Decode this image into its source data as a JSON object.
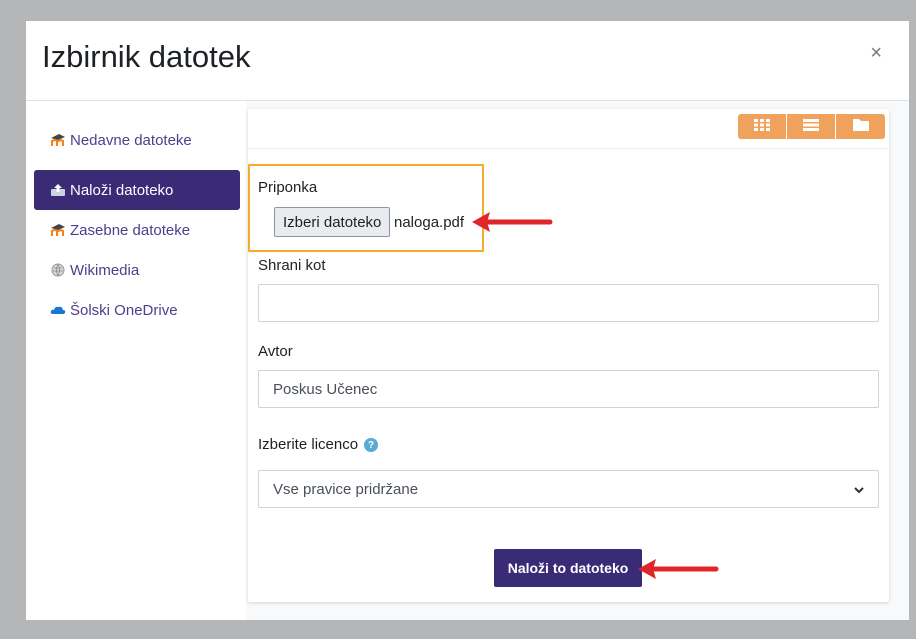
{
  "dialog": {
    "title": "Izbirnik datotek",
    "close_symbol": "×"
  },
  "sidebar": {
    "items": [
      {
        "label": "Nedavne datoteke",
        "icon": "moodle-icon",
        "active": false
      },
      {
        "label": "Naloži datoteko",
        "icon": "upload-icon",
        "active": true
      },
      {
        "label": "Zasebne datoteke",
        "icon": "moodle-icon",
        "active": false
      },
      {
        "label": "Wikimedia",
        "icon": "wikipedia-icon",
        "active": false
      },
      {
        "label": "Šolski OneDrive",
        "icon": "onedrive-icon",
        "active": false
      }
    ]
  },
  "toolbar": {
    "views": [
      "grid-view-icon",
      "list-view-icon",
      "folder-view-icon"
    ]
  },
  "form": {
    "attachment_label": "Priponka",
    "choose_file_label": "Izberi datoteko",
    "file_name": "naloga.pdf",
    "save_as_label": "Shrani kot",
    "save_as_value": "",
    "author_label": "Avtor",
    "author_value": "Poskus Učenec",
    "license_label": "Izberite licenco",
    "license_value": "Vse pravice pridržane",
    "upload_button": "Naloži to datoteko"
  },
  "colors": {
    "accent": "#392b76",
    "toolbar_buttons": "#f0a15c",
    "highlight_border": "#f4ad2a",
    "annotation_arrow": "#e0262b"
  }
}
